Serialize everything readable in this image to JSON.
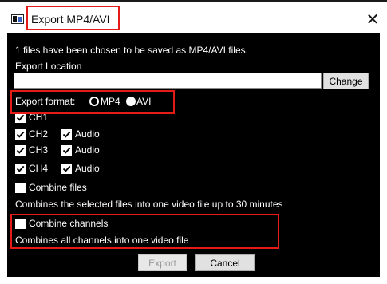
{
  "window": {
    "title": "Export MP4/AVI",
    "close_glyph": "✕"
  },
  "message": "1 files have been chosen to be saved as MP4/AVI files.",
  "export_location": {
    "label": "Export Location",
    "value": "",
    "change_label": "Change"
  },
  "export_format": {
    "label": "Export format:",
    "options": [
      {
        "label": "MP4",
        "selected": false
      },
      {
        "label": "AVI",
        "selected": true
      }
    ]
  },
  "channels": [
    {
      "label": "CH1",
      "checked": true
    },
    {
      "label": "CH2",
      "checked": true,
      "audio_label": "Audio",
      "audio_checked": true
    },
    {
      "label": "CH3",
      "checked": true,
      "audio_label": "Audio",
      "audio_checked": true
    },
    {
      "label": "CH4",
      "checked": true,
      "audio_label": "Audio",
      "audio_checked": true
    }
  ],
  "combine_files": {
    "label": "Combine files",
    "checked": false,
    "description": "Combines the selected files into one video file up to 30 minutes"
  },
  "combine_channels": {
    "label": "Combine channels",
    "checked": false,
    "description": "Combines all channels into one video file"
  },
  "buttons": {
    "export_label": "Export",
    "cancel_label": "Cancel"
  },
  "colors": {
    "panel_bg": "#000000",
    "highlight": "#e41b17",
    "text": "#ffffff"
  }
}
